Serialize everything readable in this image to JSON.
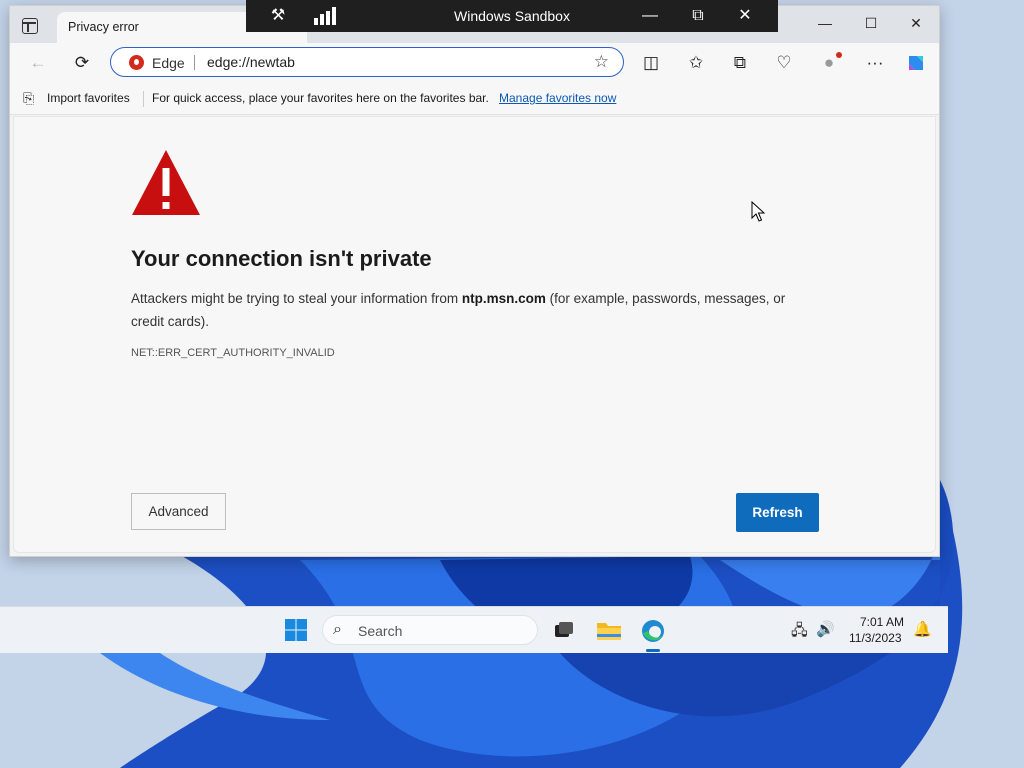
{
  "sandbox": {
    "title": "Windows Sandbox"
  },
  "tab": {
    "title": "Privacy error"
  },
  "address": {
    "badge": "Edge",
    "url": "edge://newtab"
  },
  "favorites": {
    "import_label": "Import favorites",
    "hint": "For quick access, place your favorites here on the favorites bar.",
    "manage_link": "Manage favorites now"
  },
  "error": {
    "title": "Your connection isn't private",
    "desc_prefix": "Attackers might be trying to steal your information from ",
    "host": "ntp.msn.com",
    "desc_suffix": " (for example, passwords, messages, or credit cards).",
    "code": "NET::ERR_CERT_AUTHORITY_INVALID",
    "advanced_label": "Advanced",
    "refresh_label": "Refresh"
  },
  "taskbar": {
    "search_label": "Search",
    "time": "7:01 AM",
    "date": "11/3/2023"
  },
  "colors": {
    "accent": "#0f6cbd",
    "warning": "#c80f0f",
    "edge_badge": "#d32a1e"
  }
}
